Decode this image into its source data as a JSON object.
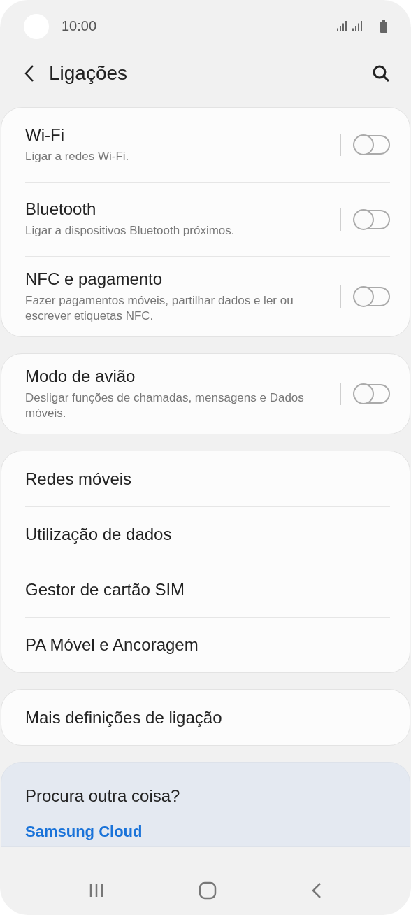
{
  "status_bar": {
    "time": "10:00"
  },
  "header": {
    "title": "Ligações"
  },
  "groups": [
    {
      "items": [
        {
          "kind": "toggle",
          "title": "Wi-Fi",
          "subtitle": "Ligar a redes Wi-Fi.",
          "on": false
        },
        {
          "kind": "toggle",
          "title": "Bluetooth",
          "subtitle": "Ligar a dispositivos Bluetooth próximos.",
          "on": false
        },
        {
          "kind": "toggle",
          "title": "NFC e pagamento",
          "subtitle": "Fazer pagamentos móveis, partilhar dados e ler ou escrever etiquetas NFC.",
          "on": false
        }
      ]
    },
    {
      "items": [
        {
          "kind": "toggle",
          "title": "Modo de avião",
          "subtitle": "Desligar funções de chamadas, mensagens e Dados móveis.",
          "on": false
        }
      ]
    },
    {
      "items": [
        {
          "kind": "link",
          "title": "Redes móveis"
        },
        {
          "kind": "link",
          "title": "Utilização de dados"
        },
        {
          "kind": "link",
          "title": "Gestor de cartão SIM"
        },
        {
          "kind": "link",
          "title": "PA Móvel e Ancoragem"
        }
      ]
    },
    {
      "items": [
        {
          "kind": "link",
          "title": "Mais definições de ligação"
        }
      ]
    }
  ],
  "suggestions": {
    "title": "Procura outra coisa?",
    "links": [
      "Samsung Cloud"
    ]
  }
}
